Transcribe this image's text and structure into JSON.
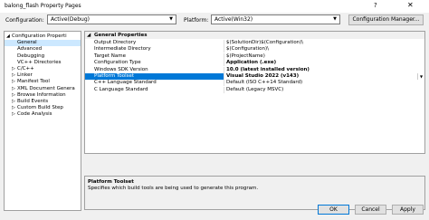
{
  "window": {
    "title": "balong_flash Property Pages",
    "help_glyph": "?",
    "close_glyph": "✕"
  },
  "config": {
    "configuration_label": "Configuration:",
    "configuration_value": "Active(Debug)",
    "platform_label": "Platform:",
    "platform_value": "Active(Win32)",
    "manager_label": "Configuration Manager..."
  },
  "tree": [
    {
      "label": "Configuration Properti",
      "expander": "◢"
    },
    {
      "label": "General",
      "selected": true
    },
    {
      "label": "Advanced"
    },
    {
      "label": "Debugging"
    },
    {
      "label": "VC++ Directories"
    },
    {
      "label": "C/C++",
      "expander": "▷"
    },
    {
      "label": "Linker",
      "expander": "▷"
    },
    {
      "label": "Manifest Tool",
      "expander": "▷"
    },
    {
      "label": "XML Document Genera",
      "expander": "▷"
    },
    {
      "label": "Browse Information",
      "expander": "▷"
    },
    {
      "label": "Build Events",
      "expander": "▷"
    },
    {
      "label": "Custom Build Step",
      "expander": "▷"
    },
    {
      "label": "Code Analysis",
      "expander": "▷"
    }
  ],
  "grid": {
    "section_collapse": "◢",
    "section_title": "General Properties",
    "rows": [
      {
        "name": "Output Directory",
        "value": "$(SolutionDir)$(Configuration)\\"
      },
      {
        "name": "Intermediate Directory",
        "value": "$(Configuration)\\"
      },
      {
        "name": "Target Name",
        "value": "$(ProjectName)"
      },
      {
        "name": "Configuration Type",
        "value": "Application (.exe)",
        "bold": true
      },
      {
        "name": "Windows SDK Version",
        "value": "10.0 (latest installed version)",
        "bold": true
      },
      {
        "name": "Platform Toolset",
        "value": "Visual Studio 2022 (v143)",
        "bold": true,
        "selected": true
      },
      {
        "name": "C++ Language Standard",
        "value": "Default (ISO C++14 Standard)"
      },
      {
        "name": "C Language Standard",
        "value": "Default (Legacy MSVC)"
      }
    ],
    "dropdown_arrow": "▼"
  },
  "description": {
    "title": "Platform Toolset",
    "text": "Specifies which build tools are being used to generate this program."
  },
  "buttons": {
    "ok": "OK",
    "cancel": "Cancel",
    "apply": "Apply"
  }
}
